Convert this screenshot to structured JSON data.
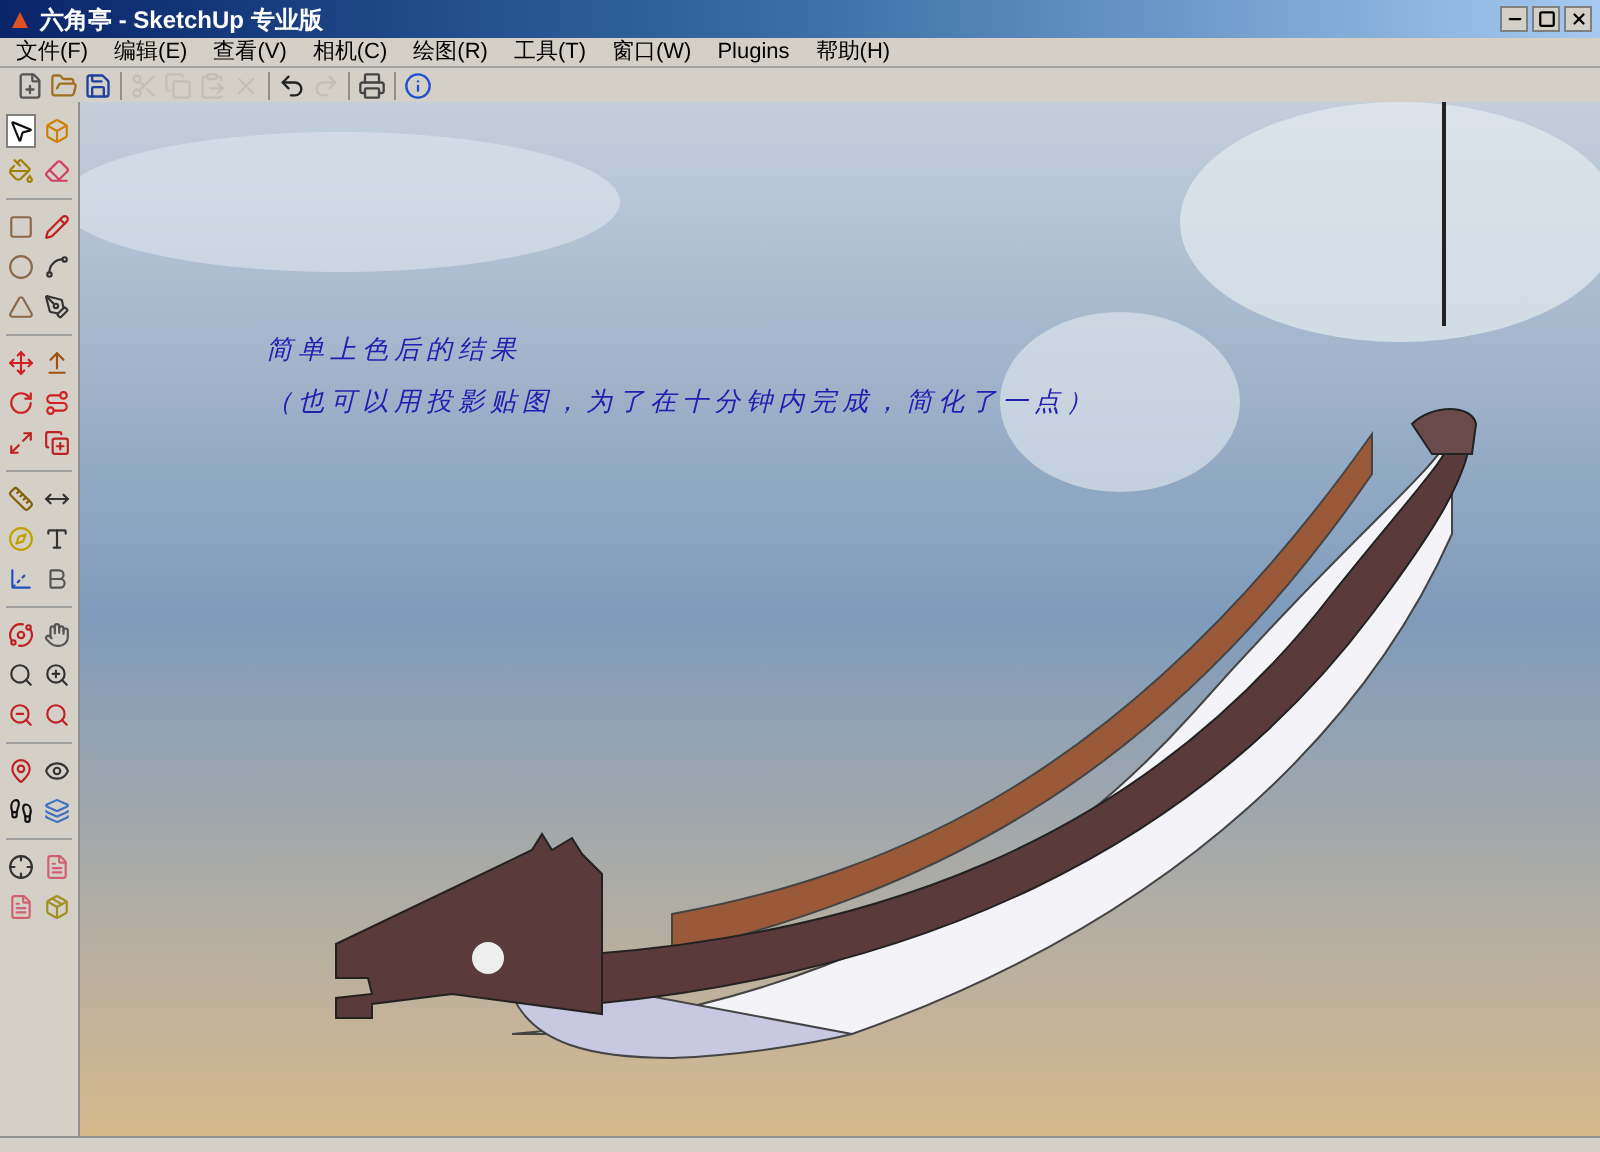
{
  "window": {
    "title": "六角亭 - SketchUp 专业版"
  },
  "menu": [
    {
      "label": "文件(F)"
    },
    {
      "label": "编辑(E)"
    },
    {
      "label": "查看(V)"
    },
    {
      "label": "相机(C)"
    },
    {
      "label": "绘图(R)"
    },
    {
      "label": "工具(T)"
    },
    {
      "label": "窗口(W)"
    },
    {
      "label": "Plugins"
    },
    {
      "label": "帮助(H)"
    }
  ],
  "toolbar_groups": [
    {
      "items": [
        {
          "kind": "new",
          "disabled": false
        },
        {
          "kind": "open",
          "disabled": false
        },
        {
          "kind": "save",
          "disabled": false
        }
      ]
    },
    {
      "items": [
        {
          "kind": "cut",
          "disabled": true
        },
        {
          "kind": "copy",
          "disabled": true
        },
        {
          "kind": "paste",
          "disabled": true
        },
        {
          "kind": "delete",
          "disabled": true
        }
      ]
    },
    {
      "items": [
        {
          "kind": "undo",
          "disabled": false
        },
        {
          "kind": "redo",
          "disabled": true
        }
      ]
    },
    {
      "items": [
        {
          "kind": "print",
          "disabled": false
        }
      ]
    },
    {
      "items": [
        {
          "kind": "info",
          "disabled": false
        }
      ]
    }
  ],
  "tool_groups": [
    {
      "items": [
        {
          "kind": "select",
          "selected": true
        },
        {
          "kind": "component",
          "selected": false
        },
        {
          "kind": "paint",
          "selected": false
        },
        {
          "kind": "eraser",
          "selected": false
        }
      ]
    },
    {
      "items": [
        {
          "kind": "rectangle",
          "selected": false
        },
        {
          "kind": "pencil",
          "selected": false
        },
        {
          "kind": "circle",
          "selected": false
        },
        {
          "kind": "arc",
          "selected": false
        },
        {
          "kind": "polygon",
          "selected": false
        },
        {
          "kind": "freehand",
          "selected": false
        }
      ]
    },
    {
      "items": [
        {
          "kind": "move",
          "selected": false
        },
        {
          "kind": "pushpull",
          "selected": false
        },
        {
          "kind": "rotate",
          "selected": false
        },
        {
          "kind": "followme",
          "selected": false
        },
        {
          "kind": "scale",
          "selected": false
        },
        {
          "kind": "offset",
          "selected": false
        }
      ]
    },
    {
      "items": [
        {
          "kind": "tape",
          "selected": false
        },
        {
          "kind": "dimension",
          "selected": false
        },
        {
          "kind": "protractor",
          "selected": false
        },
        {
          "kind": "text",
          "selected": false
        },
        {
          "kind": "axes",
          "selected": false
        },
        {
          "kind": "text3d",
          "selected": false
        }
      ]
    },
    {
      "items": [
        {
          "kind": "orbit",
          "selected": false
        },
        {
          "kind": "pan",
          "selected": false
        },
        {
          "kind": "zoom",
          "selected": false
        },
        {
          "kind": "zoomwindow",
          "selected": false
        },
        {
          "kind": "zoomprev",
          "selected": false
        },
        {
          "kind": "zoomnext",
          "selected": false
        }
      ]
    },
    {
      "items": [
        {
          "kind": "position",
          "selected": false
        },
        {
          "kind": "lookaround",
          "selected": false
        },
        {
          "kind": "walk",
          "selected": false
        },
        {
          "kind": "section",
          "selected": false
        }
      ]
    },
    {
      "items": [
        {
          "kind": "target",
          "selected": false
        },
        {
          "kind": "page",
          "selected": false
        },
        {
          "kind": "page",
          "selected": false
        },
        {
          "kind": "cube",
          "selected": false
        }
      ]
    }
  ],
  "canvas": {
    "note": [
      "简单上色后的结果",
      "（也可以用投影贴图，为了在十分钟内完成，简化了一点）"
    ]
  }
}
